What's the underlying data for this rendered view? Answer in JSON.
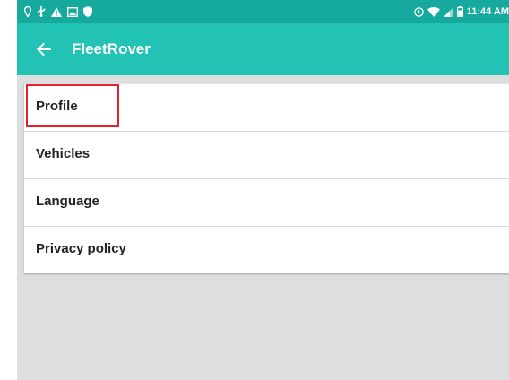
{
  "status_bar": {
    "time": "11:44 AM",
    "left_icons": [
      "location-icon",
      "usb-icon",
      "warning-icon",
      "image-icon",
      "shield-icon"
    ],
    "right_icons": [
      "alarm-icon",
      "wifi-icon",
      "signal-icon",
      "battery-icon"
    ]
  },
  "app_bar": {
    "title": "FleetRover",
    "back_icon": "arrow-left-icon"
  },
  "menu": {
    "items": [
      {
        "label": "Profile",
        "highlighted": true
      },
      {
        "label": "Vehicles"
      },
      {
        "label": "Language"
      },
      {
        "label": "Privacy policy"
      }
    ]
  },
  "colors": {
    "status_bar": "#16a99d",
    "app_bar": "#22c3b4",
    "highlight": "#e8202c",
    "background": "#dedede"
  }
}
